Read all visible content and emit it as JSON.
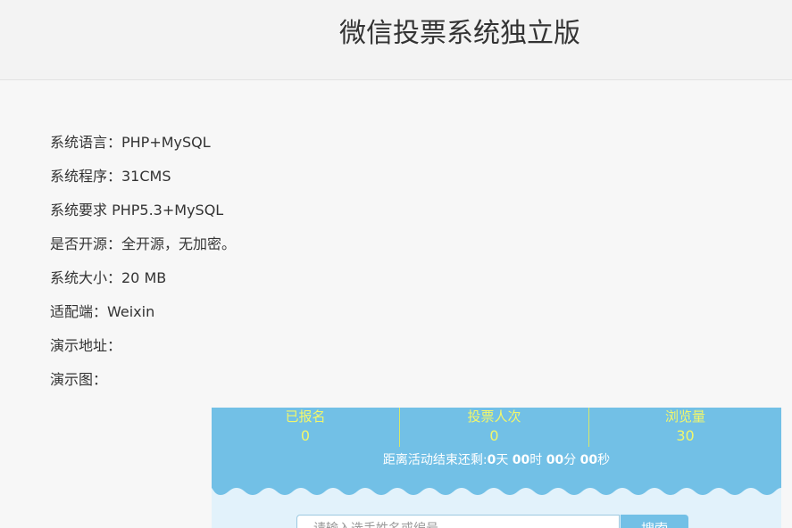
{
  "header": {
    "title": "微信投票系统独立版"
  },
  "info": {
    "items": [
      "系统语言：PHP+MySQL",
      "系统程序：31CMS",
      "系统要求 PHP5.3+MySQL",
      "是否开源：全开源，无加密。",
      "系统大小：20 MB",
      "适配端：Weixin",
      "演示地址：",
      "演示图："
    ]
  },
  "demo": {
    "stats": [
      {
        "label": "已报名",
        "value": "0"
      },
      {
        "label": "投票人次",
        "value": "0"
      },
      {
        "label": "浏览量",
        "value": "30"
      }
    ],
    "countdown": {
      "prefix": "距离活动结束还剩:",
      "days": "0",
      "days_unit": "天 ",
      "hours": "00",
      "hours_unit": "时 ",
      "minutes": "00",
      "minutes_unit": "分 ",
      "seconds": "00",
      "seconds_unit": "秒"
    },
    "search": {
      "placeholder": "请输入选手姓名或编号",
      "button_label": "搜索"
    }
  },
  "colors": {
    "banner": "#72c0e6",
    "stat_text": "#f3f76a",
    "page_bg": "#f7f7f7"
  }
}
